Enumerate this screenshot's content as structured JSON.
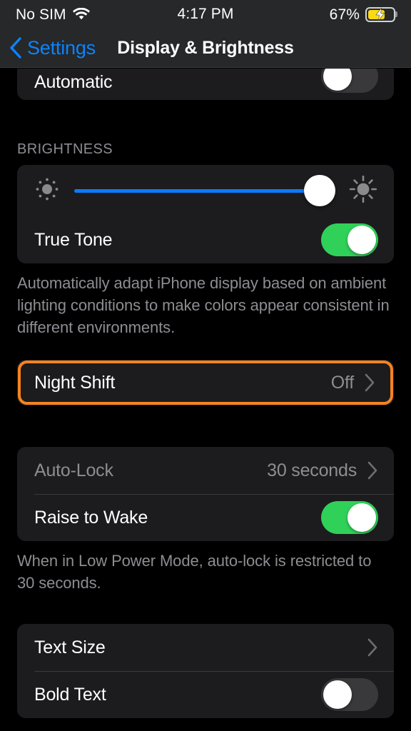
{
  "status_bar": {
    "carrier": "No SIM",
    "wifi_icon": "wifi-icon",
    "time": "4:17 PM",
    "battery_percent": "67%",
    "battery_level": 67,
    "battery_charging": true,
    "battery_color": "#fcd913"
  },
  "nav": {
    "back_label": "Settings",
    "back_icon": "chevron-left-icon",
    "title": "Display & Brightness",
    "accent_color": "#0a84ff"
  },
  "appearance_section": {
    "automatic": {
      "label": "Automatic",
      "toggle": "off"
    }
  },
  "brightness_section": {
    "header": "BRIGHTNESS",
    "slider": {
      "name": "brightness-slider",
      "value": 94,
      "min_icon": "sun-small-icon",
      "max_icon": "sun-large-icon",
      "fill_color": "#0a7cff"
    },
    "true_tone": {
      "label": "True Tone",
      "toggle": "on"
    },
    "footer": "Automatically adapt iPhone display based on ambient lighting conditions to make colors appear consistent in different environments."
  },
  "night_shift": {
    "label": "Night Shift",
    "value": "Off",
    "chevron_icon": "chevron-right-icon",
    "highlighted": true,
    "highlight_color": "#f5831f"
  },
  "autolock_section": {
    "auto_lock": {
      "label": "Auto-Lock",
      "value": "30 seconds",
      "chevron_icon": "chevron-right-icon",
      "disabled": true
    },
    "raise_to_wake": {
      "label": "Raise to Wake",
      "toggle": "on"
    },
    "footer": "When in Low Power Mode, auto-lock is restricted to 30 seconds."
  },
  "text_section": {
    "text_size": {
      "label": "Text Size",
      "chevron_icon": "chevron-right-icon"
    },
    "bold_text": {
      "label": "Bold Text",
      "toggle": "off"
    }
  },
  "colors": {
    "background": "#000000",
    "card": "#1c1c1e",
    "navbar": "#262829",
    "toggle_on": "#30d158",
    "toggle_off": "#39393c",
    "secondary_text": "#8d8d92"
  }
}
